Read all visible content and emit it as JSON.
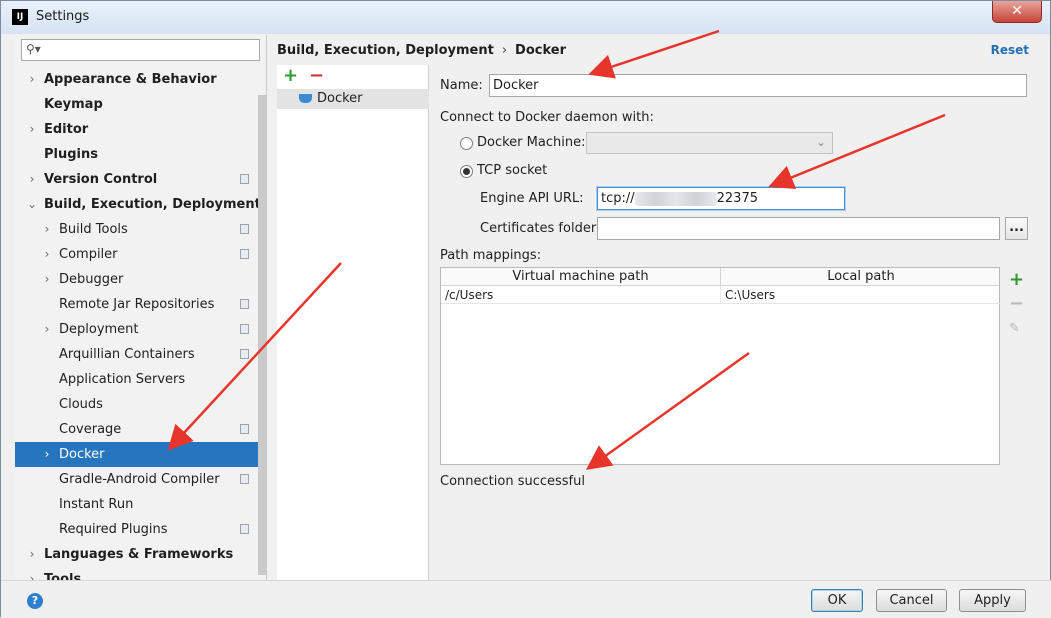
{
  "window": {
    "title": "Settings",
    "app_icon": "IJ",
    "close_symbol": "✕"
  },
  "sidebar": {
    "search_placeholder": "",
    "items": [
      {
        "label": "Appearance & Behavior",
        "level": 0,
        "arrow": "›",
        "bold": true
      },
      {
        "label": "Keymap",
        "level": 0,
        "arrow": "",
        "bold": true
      },
      {
        "label": "Editor",
        "level": 0,
        "arrow": "›",
        "bold": true
      },
      {
        "label": "Plugins",
        "level": 0,
        "arrow": "",
        "bold": true
      },
      {
        "label": "Version Control",
        "level": 0,
        "arrow": "›",
        "bold": true,
        "project": true
      },
      {
        "label": "Build, Execution, Deployment",
        "level": 0,
        "arrow": "⌄",
        "bold": true
      },
      {
        "label": "Build Tools",
        "level": 1,
        "arrow": "›",
        "project": true
      },
      {
        "label": "Compiler",
        "level": 1,
        "arrow": "›",
        "project": true
      },
      {
        "label": "Debugger",
        "level": 1,
        "arrow": "›"
      },
      {
        "label": "Remote Jar Repositories",
        "level": 1,
        "arrow": "",
        "project": true
      },
      {
        "label": "Deployment",
        "level": 1,
        "arrow": "›",
        "project": true
      },
      {
        "label": "Arquillian Containers",
        "level": 1,
        "arrow": "",
        "project": true
      },
      {
        "label": "Application Servers",
        "level": 1,
        "arrow": ""
      },
      {
        "label": "Clouds",
        "level": 1,
        "arrow": ""
      },
      {
        "label": "Coverage",
        "level": 1,
        "arrow": "",
        "project": true
      },
      {
        "label": "Docker",
        "level": 1,
        "arrow": "›",
        "selected": true
      },
      {
        "label": "Gradle-Android Compiler",
        "level": 1,
        "arrow": "",
        "project": true
      },
      {
        "label": "Instant Run",
        "level": 1,
        "arrow": ""
      },
      {
        "label": "Required Plugins",
        "level": 1,
        "arrow": "",
        "project": true
      },
      {
        "label": "Languages & Frameworks",
        "level": 0,
        "arrow": "›",
        "bold": true
      },
      {
        "label": "Tools",
        "level": 0,
        "arrow": "›",
        "bold": true
      }
    ]
  },
  "header": {
    "crumb_parent": "Build, Execution, Deployment",
    "crumb_separator": "›",
    "crumb_current": "Docker",
    "reset_label": "Reset"
  },
  "config_list": {
    "add_symbol": "+",
    "remove_symbol": "−",
    "items": [
      "Docker"
    ]
  },
  "form": {
    "name_label": "Name:",
    "name_value": "Docker",
    "connect_label": "Connect to Docker daemon with:",
    "docker_machine_label": "Docker Machine:",
    "docker_machine_value": "",
    "tcp_socket_label": "TCP socket",
    "engine_api_label": "Engine API URL:",
    "engine_api_prefix": "tcp://",
    "engine_api_suffix": "22375",
    "certificates_label": "Certificates folder:",
    "certificates_value": "",
    "browse_label": "...",
    "path_mappings_label": "Path mappings:",
    "table": {
      "columns": [
        "Virtual machine path",
        "Local path"
      ],
      "rows": [
        [
          "/c/Users",
          "C:\\Users"
        ]
      ]
    },
    "table_tools": {
      "add": "+",
      "remove": "−",
      "edit": "✎"
    },
    "status_text": "Connection successful"
  },
  "footer": {
    "help_symbol": "?",
    "ok_label": "OK",
    "cancel_label": "Cancel",
    "apply_label": "Apply"
  },
  "colors": {
    "selection": "#2675bf",
    "link": "#2470b3",
    "annotation_arrow": "#e8352b"
  }
}
